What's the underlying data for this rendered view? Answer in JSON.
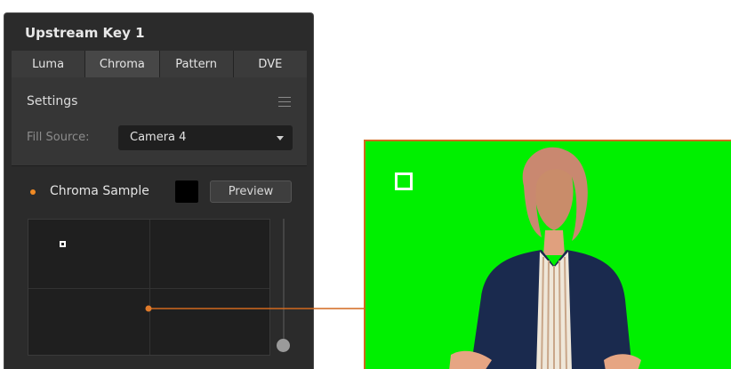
{
  "panel": {
    "title": "Upstream Key 1",
    "tabs": [
      {
        "label": "Luma"
      },
      {
        "label": "Chroma"
      },
      {
        "label": "Pattern"
      },
      {
        "label": "DVE"
      }
    ],
    "active_tab": "Chroma",
    "settings": {
      "heading": "Settings",
      "fill_source_label": "Fill Source:",
      "fill_source_value": "Camera 4"
    },
    "chroma_sample": {
      "label": "Chroma Sample",
      "preview_label": "Preview",
      "indicator_color": "#f08a24",
      "swatch_color": "#000000"
    }
  },
  "preview_image": {
    "background_color": "#00f000",
    "border_color": "#d2691e"
  },
  "icons": [
    "menu-icon",
    "chevron-down-icon",
    "selection-marker-icon"
  ]
}
